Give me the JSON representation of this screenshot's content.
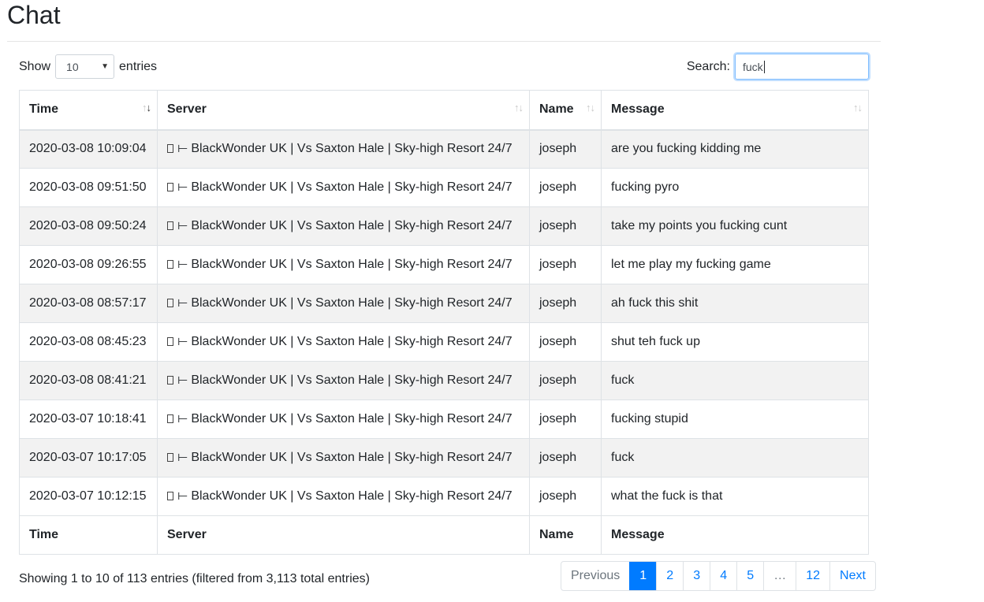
{
  "page": {
    "title": "Chat"
  },
  "length": {
    "show_label": "Show",
    "value": "10",
    "entries_label": "entries"
  },
  "search": {
    "label": "Search:",
    "value": "fuck"
  },
  "table": {
    "headers": [
      "Time",
      "Server",
      "Name",
      "Message"
    ],
    "rows": [
      {
        "time": "2020-03-08 10:09:04",
        "server": "BlackWonder UK | Vs Saxton Hale | Sky-high Resort 24/7",
        "name": "joseph",
        "message": "are you fucking kidding me"
      },
      {
        "time": "2020-03-08 09:51:50",
        "server": "BlackWonder UK | Vs Saxton Hale | Sky-high Resort 24/7",
        "name": "joseph",
        "message": "fucking pyro"
      },
      {
        "time": "2020-03-08 09:50:24",
        "server": "BlackWonder UK | Vs Saxton Hale | Sky-high Resort 24/7",
        "name": "joseph",
        "message": "take my points you fucking cunt"
      },
      {
        "time": "2020-03-08 09:26:55",
        "server": "BlackWonder UK | Vs Saxton Hale | Sky-high Resort 24/7",
        "name": "joseph",
        "message": "let me play my fucking game"
      },
      {
        "time": "2020-03-08 08:57:17",
        "server": "BlackWonder UK | Vs Saxton Hale | Sky-high Resort 24/7",
        "name": "joseph",
        "message": "ah fuck this shit"
      },
      {
        "time": "2020-03-08 08:45:23",
        "server": "BlackWonder UK | Vs Saxton Hale | Sky-high Resort 24/7",
        "name": "joseph",
        "message": "shut teh fuck up"
      },
      {
        "time": "2020-03-08 08:41:21",
        "server": "BlackWonder UK | Vs Saxton Hale | Sky-high Resort 24/7",
        "name": "joseph",
        "message": "fuck"
      },
      {
        "time": "2020-03-07 10:18:41",
        "server": "BlackWonder UK | Vs Saxton Hale | Sky-high Resort 24/7",
        "name": "joseph",
        "message": "fucking stupid"
      },
      {
        "time": "2020-03-07 10:17:05",
        "server": "BlackWonder UK | Vs Saxton Hale | Sky-high Resort 24/7",
        "name": "joseph",
        "message": "fuck"
      },
      {
        "time": "2020-03-07 10:12:15",
        "server": "BlackWonder UK | Vs Saxton Hale | Sky-high Resort 24/7",
        "name": "joseph",
        "message": "what the fuck is that"
      }
    ],
    "server_icons": [
      "box-icon",
      "flag-icon"
    ],
    "stripe_color": "#f2f2f2",
    "sort": {
      "column": "Time",
      "direction": "descending"
    }
  },
  "footer": {
    "info": "Showing 1 to 10 of 113 entries (filtered from 3,113 total entries)",
    "pagination": [
      "Previous",
      "1",
      "2",
      "3",
      "4",
      "5",
      "…",
      "12",
      "Next"
    ],
    "active_page": "1"
  },
  "colors": {
    "accent": "#007bff"
  }
}
